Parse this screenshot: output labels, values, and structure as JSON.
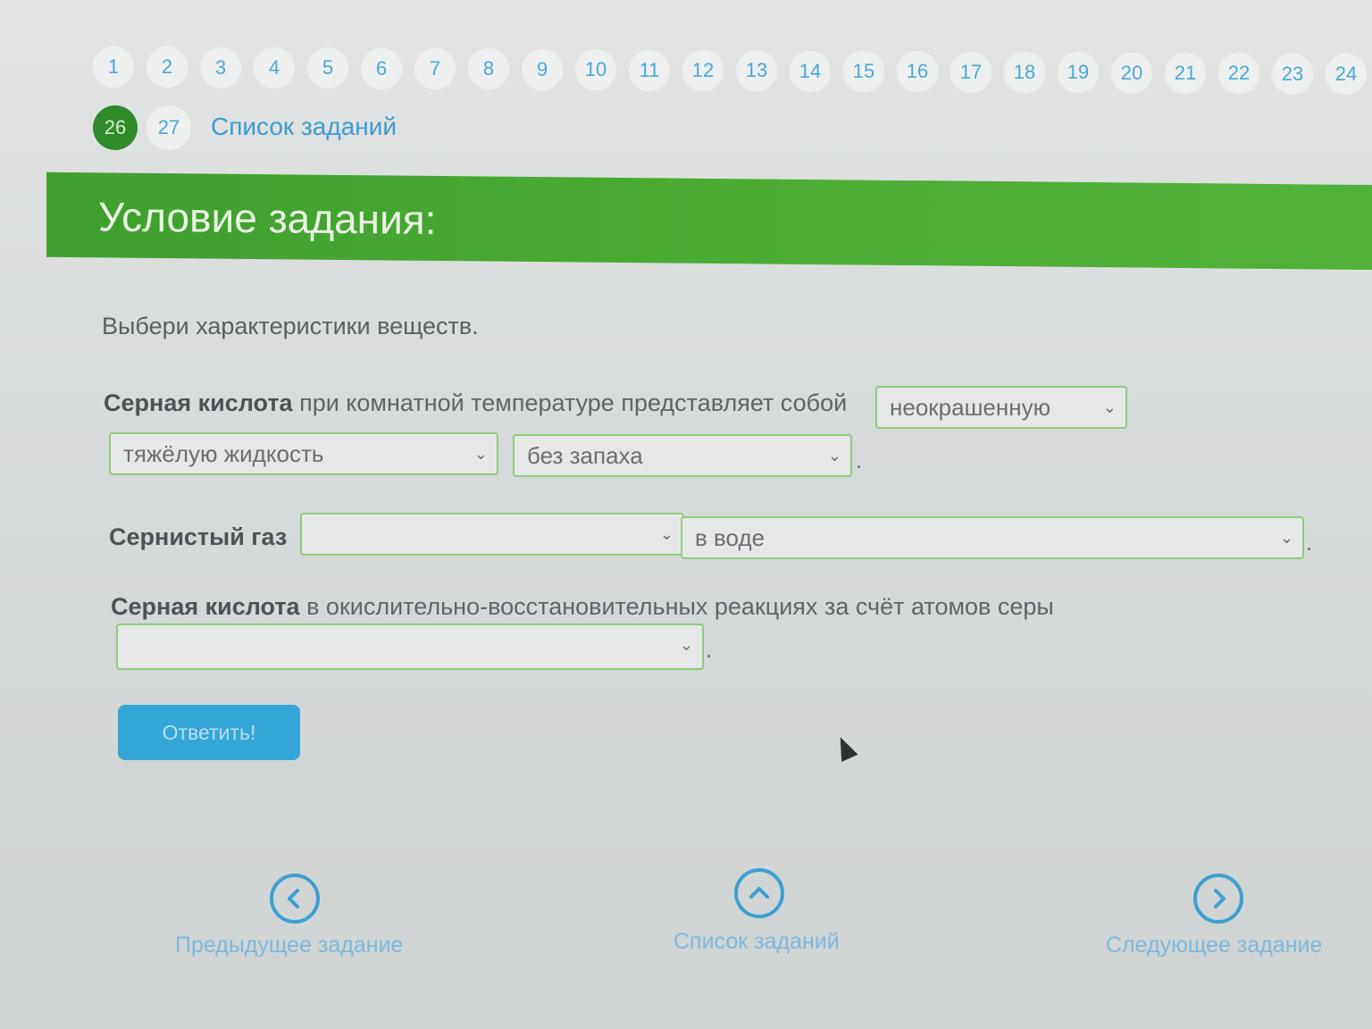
{
  "task_numbers": {
    "row1": [
      "1",
      "2",
      "3",
      "4",
      "5",
      "6",
      "7",
      "8",
      "9",
      "10",
      "11",
      "12",
      "13",
      "14",
      "15",
      "16",
      "17",
      "18",
      "19",
      "20",
      "21",
      "22",
      "23",
      "24"
    ],
    "active": "26",
    "next": "27",
    "task_list_link": "Список заданий"
  },
  "header": {
    "title": "Условие задания:"
  },
  "task": {
    "instruction": "Выбери характеристики веществ.",
    "q1": {
      "bold": "Серная кислота",
      "text": " при комнатной температуре представляет собой",
      "select1": "неокрашенную",
      "select2": "тяжёлую жидкость",
      "select3": "без запаха",
      "end": "."
    },
    "q2": {
      "bold": "Сернистый газ",
      "select1": "",
      "select2": "в воде",
      "end": "."
    },
    "q3": {
      "bold": "Серная кислота",
      "text": " в окислительно-восстановительных реакциях за счёт атомов серы",
      "select1": "",
      "end": "."
    }
  },
  "buttons": {
    "answer": "Ответить!"
  },
  "bottom_nav": {
    "prev": "Предыдущее задание",
    "list": "Список заданий",
    "next": "Следующее задание"
  },
  "colors": {
    "accent_green": "#4cae34",
    "accent_blue": "#35a6d8",
    "select_border": "#8fcc7d"
  }
}
